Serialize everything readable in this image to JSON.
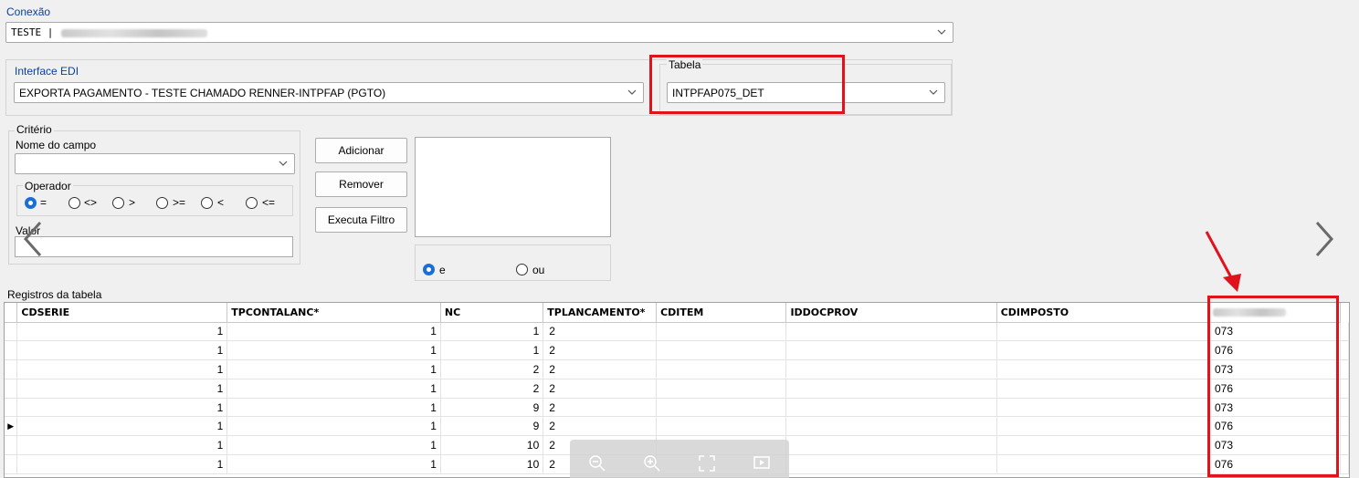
{
  "connection": {
    "label": "Conexão",
    "value": "TESTE |"
  },
  "edi": {
    "label": "Interface EDI",
    "value": "EXPORTA PAGAMENTO - TESTE CHAMADO RENNER-INTPFAP (PGTO)"
  },
  "table_select": {
    "label": "Tabela",
    "value": "INTPFAP075_DET"
  },
  "criteria": {
    "group_label": "Critério",
    "field_label": "Nome do campo",
    "field_value": "",
    "operator_label": "Operador",
    "operators": [
      "=",
      "<>",
      ">",
      ">=",
      "<",
      "<="
    ],
    "selected_operator": "=",
    "value_label": "Valor",
    "value": ""
  },
  "buttons": {
    "add": "Adicionar",
    "remove": "Remover",
    "run_filter": "Executa Filtro"
  },
  "logic": {
    "and_label": "e",
    "or_label": "ou",
    "selected": "e"
  },
  "records": {
    "label": "Registros da tabela",
    "columns": [
      "CDSERIE",
      "TPCONTALANC*",
      "NC",
      "TPLANCAMENTO*",
      "CDITEM",
      "IDDOCPROV",
      "CDIMPOSTO",
      ""
    ],
    "rows": [
      [
        "1",
        "1",
        "1",
        "2",
        "",
        "",
        "",
        "073"
      ],
      [
        "1",
        "1",
        "1",
        "2",
        "",
        "",
        "",
        "076"
      ],
      [
        "1",
        "1",
        "2",
        "2",
        "",
        "",
        "",
        "073"
      ],
      [
        "1",
        "1",
        "2",
        "2",
        "",
        "",
        "",
        "076"
      ],
      [
        "1",
        "1",
        "9",
        "2",
        "",
        "",
        "",
        "073"
      ],
      [
        "1",
        "1",
        "9",
        "2",
        "",
        "",
        "",
        "076"
      ],
      [
        "1",
        "1",
        "10",
        "2",
        "",
        "",
        "",
        "073"
      ],
      [
        "1",
        "1",
        "10",
        "2",
        "",
        "",
        "",
        "076"
      ]
    ],
    "current_row": 5
  },
  "icons": {
    "prev": "chevron-left-icon",
    "next": "chevron-right-icon",
    "zoom_out": "zoom-out-icon",
    "zoom_in": "zoom-in-icon",
    "fullscreen": "fullscreen-icon",
    "slideshow": "slideshow-icon"
  },
  "colors": {
    "annotation": "#e0121b",
    "radio_selected": "#1a6fd6",
    "label_blue": "#0a3fa5"
  }
}
